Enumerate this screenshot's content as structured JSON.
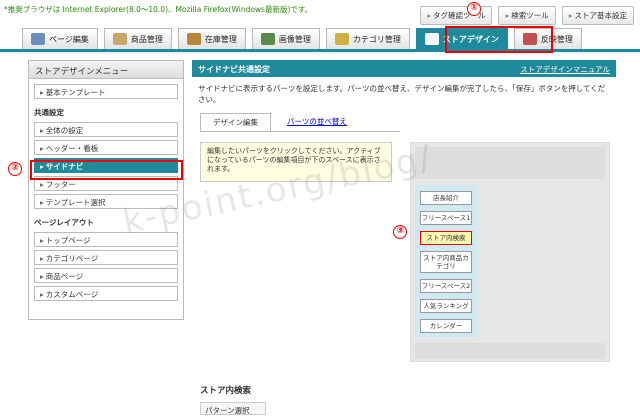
{
  "notice": "*推奨ブラウザは Internet Explorer(8.0〜10.0)、Mozilla Firefox(Windows最新版)です。",
  "toplinks": [
    "タグ確認ツール",
    "検索ツール",
    "ストア基本設定"
  ],
  "tabs": [
    "ページ編集",
    "商品管理",
    "在庫管理",
    "画像管理",
    "カテゴリ管理",
    "ストアデザイン",
    "反映管理"
  ],
  "sidebar": {
    "title": "ストアデザインメニュー",
    "basic_template": "基本テンプレート",
    "common_section": "共通設定",
    "common_items": [
      "全体の設定",
      "ヘッダー・看板",
      "サイドナビ",
      "フッター",
      "テンプレート選択"
    ],
    "layout_section": "ページレイアウト",
    "layout_items": [
      "トップページ",
      "カテゴリページ",
      "商品ページ",
      "カスタムページ"
    ]
  },
  "main": {
    "title": "サイドナビ共通設定",
    "manual_link": "ストアデザインマニュアル",
    "description": "サイドナビに表示するパーツを設定します。パーツの並べ替え、デザイン編集が完了したら、「保存」ボタンを押してください。",
    "subtab_active": "デザイン編集",
    "subtab_link": "パーツの並べ替え",
    "info_text": "編集したいパーツをクリックしてください。アクティブになっているパーツの編集項目が下のスペースに表示されます。",
    "parts": [
      "店長紹介",
      "フリースペース1",
      "ストア内検索",
      "ストア内商品カテゴリ",
      "フリースペース2",
      "人気ランキング",
      "カレンダー"
    ],
    "section_title": "ストア内検索",
    "section_sub": "パターン選択"
  },
  "callouts": [
    "①",
    "②",
    "③"
  ],
  "watermark": "k-point.org/blog/",
  "colors": {
    "accent": "#1e8a9c",
    "highlight": "#e00000",
    "notice": "#2c8a0a"
  }
}
